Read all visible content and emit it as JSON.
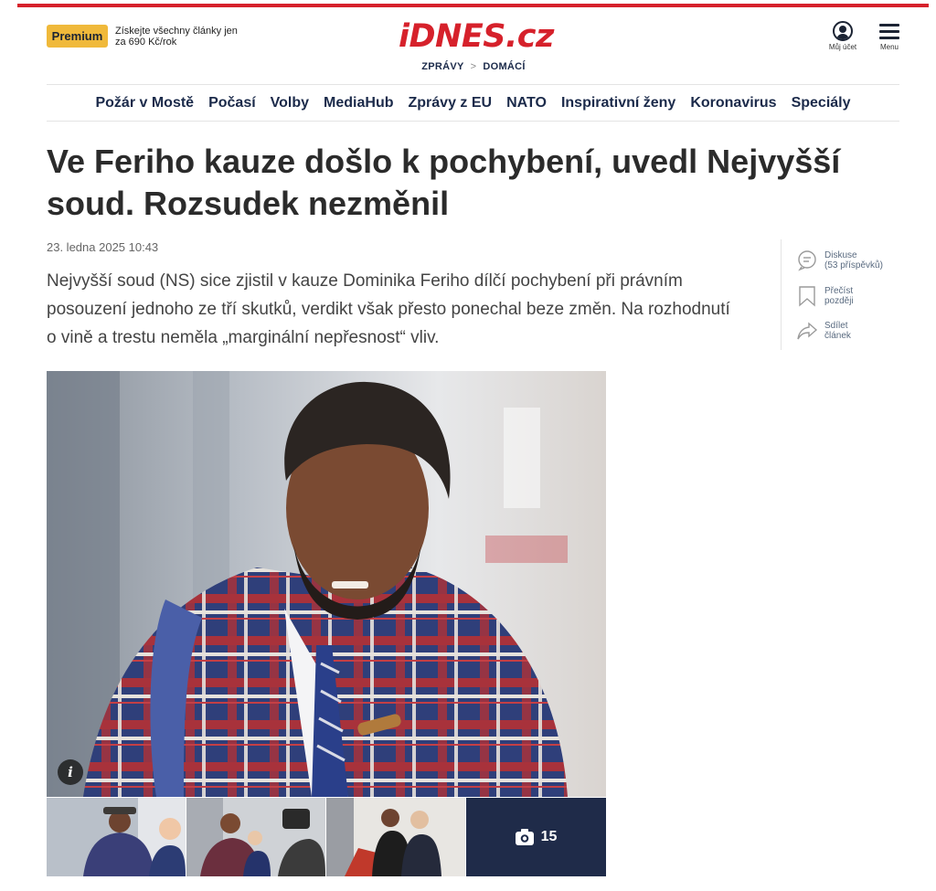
{
  "header": {
    "premium_label": "Premium",
    "premium_text": "Získejte všechny články jen za 690 Kč/rok",
    "logo_text": "iDNES.cz",
    "breadcrumb": [
      "ZPRÁVY",
      "DOMÁCÍ"
    ],
    "account_label": "Můj účet",
    "menu_label": "Menu"
  },
  "nav": {
    "items": [
      "Požár v Mostě",
      "Počasí",
      "Volby",
      "MediaHub",
      "Zprávy z EU",
      "NATO",
      "Inspirativní ženy",
      "Koronavirus",
      "Speciály"
    ]
  },
  "article": {
    "title": "Ve Feriho kauze došlo k pochybení, uvedl Nejvyšší soud. Rozsudek nezměnil",
    "date": "23. ledna 2025  10:43",
    "perex": "Nejvyšší soud (NS) sice zjistil v kauze Dominika Feriho dílčí pochybení při právním posouzení jednoho ze tří skutků, verdikt však přesto ponechal beze změn. Na rozhodnutí o vině a trestu neměla „marginální nepřesnost“ vliv."
  },
  "tools": {
    "discussion": [
      "Diskuse",
      "(53 příspěvků)"
    ],
    "read_later": [
      "Přečíst",
      "později"
    ],
    "share": [
      "Sdílet",
      "článek"
    ]
  },
  "gallery": {
    "info_icon": "info-icon",
    "photo_count": "15",
    "camera_icon": "camera-icon"
  },
  "colors": {
    "brand_red": "#d6212b",
    "premium_yellow": "#f0b93a",
    "nav_blue": "#1b2a4a",
    "gallery_navy": "#1f2b49"
  }
}
